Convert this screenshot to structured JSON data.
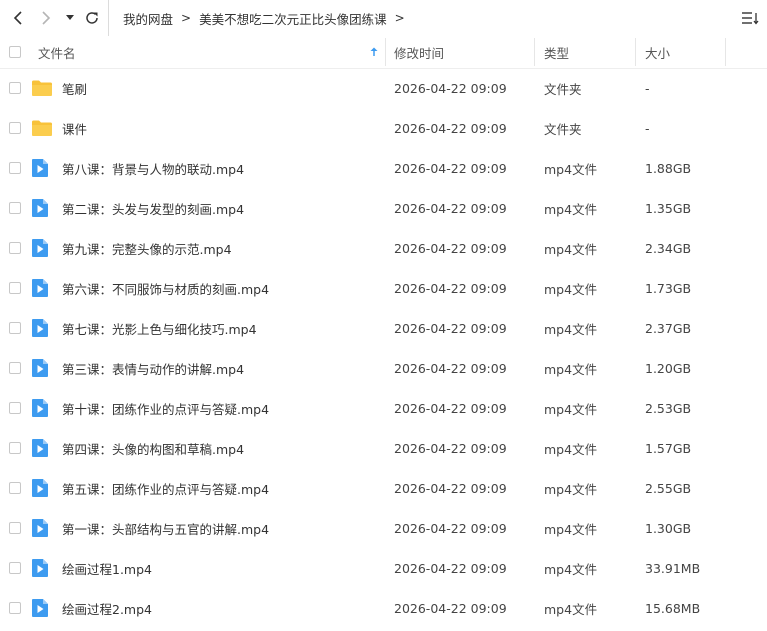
{
  "nav": {
    "breadcrumb_root": "我的网盘",
    "breadcrumb_current": "美美不想吃二次元正比头像团练课"
  },
  "columns": {
    "name": "文件名",
    "modified": "修改时间",
    "type": "类型",
    "size": "大小"
  },
  "colors": {
    "folder": "#f8c23a",
    "video": "#3d9bf0"
  },
  "files": [
    {
      "name": "笔刷",
      "modified": "2026-04-22 09:09",
      "type": "文件夹",
      "size": "-",
      "icon": "folder-icon"
    },
    {
      "name": "课件",
      "modified": "2026-04-22 09:09",
      "type": "文件夹",
      "size": "-",
      "icon": "folder-icon"
    },
    {
      "name": "第八课：背景与人物的联动.mp4",
      "modified": "2026-04-22 09:09",
      "type": "mp4文件",
      "size": "1.88GB",
      "icon": "video-icon"
    },
    {
      "name": "第二课：头发与发型的刻画.mp4",
      "modified": "2026-04-22 09:09",
      "type": "mp4文件",
      "size": "1.35GB",
      "icon": "video-icon"
    },
    {
      "name": "第九课：完整头像的示范.mp4",
      "modified": "2026-04-22 09:09",
      "type": "mp4文件",
      "size": "2.34GB",
      "icon": "video-icon"
    },
    {
      "name": "第六课：不同服饰与材质的刻画.mp4",
      "modified": "2026-04-22 09:09",
      "type": "mp4文件",
      "size": "1.73GB",
      "icon": "video-icon"
    },
    {
      "name": "第七课：光影上色与细化技巧.mp4",
      "modified": "2026-04-22 09:09",
      "type": "mp4文件",
      "size": "2.37GB",
      "icon": "video-icon"
    },
    {
      "name": "第三课：表情与动作的讲解.mp4",
      "modified": "2026-04-22 09:09",
      "type": "mp4文件",
      "size": "1.20GB",
      "icon": "video-icon"
    },
    {
      "name": "第十课：团练作业的点评与答疑.mp4",
      "modified": "2026-04-22 09:09",
      "type": "mp4文件",
      "size": "2.53GB",
      "icon": "video-icon"
    },
    {
      "name": "第四课：头像的构图和草稿.mp4",
      "modified": "2026-04-22 09:09",
      "type": "mp4文件",
      "size": "1.57GB",
      "icon": "video-icon"
    },
    {
      "name": "第五课：团练作业的点评与答疑.mp4",
      "modified": "2026-04-22 09:09",
      "type": "mp4文件",
      "size": "2.55GB",
      "icon": "video-icon"
    },
    {
      "name": "第一课：头部结构与五官的讲解.mp4",
      "modified": "2026-04-22 09:09",
      "type": "mp4文件",
      "size": "1.30GB",
      "icon": "video-icon"
    },
    {
      "name": "绘画过程1.mp4",
      "modified": "2026-04-22 09:09",
      "type": "mp4文件",
      "size": "33.91MB",
      "icon": "video-icon"
    },
    {
      "name": "绘画过程2.mp4",
      "modified": "2026-04-22 09:09",
      "type": "mp4文件",
      "size": "15.68MB",
      "icon": "video-icon"
    }
  ]
}
